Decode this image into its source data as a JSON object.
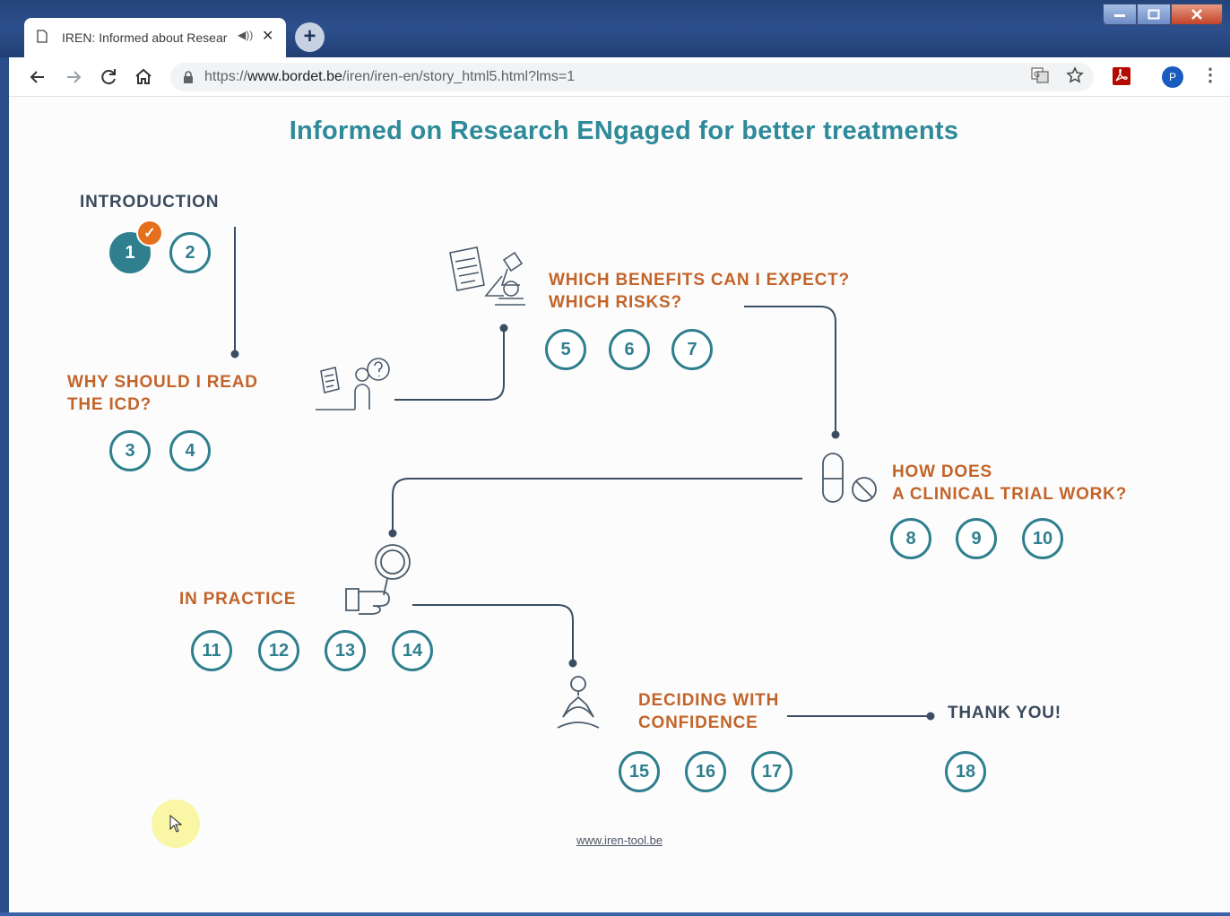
{
  "browser": {
    "tab_title": "IREN: Informed about Resear",
    "url_prefix": "https://",
    "url_host": "www.bordet.be",
    "url_path": "/iren/iren-en/story_html5.html?lms=1",
    "profile_initial": "P"
  },
  "page": {
    "title": "Informed on Research ENgaged for better treatments",
    "footer_link": "www.iren-tool.be",
    "accent_color": "#2f7f8f",
    "title_color": "#2e8a99",
    "section_color": "#c2642a",
    "check_color": "#e66f1e"
  },
  "sections": {
    "introduction": {
      "title": "INTRODUCTION",
      "modules": [
        "1",
        "2"
      ]
    },
    "why_read": {
      "line1": "WHY SHOULD I READ",
      "line2": "THE ICD?",
      "modules": [
        "3",
        "4"
      ]
    },
    "benefits": {
      "line1": "WHICH BENEFITS CAN I EXPECT?",
      "line2": "WHICH RISKS?",
      "modules": [
        "5",
        "6",
        "7"
      ]
    },
    "clinical_trial": {
      "line1": "HOW DOES",
      "line2": "A CLINICAL TRIAL WORK?",
      "modules": [
        "8",
        "9",
        "10"
      ]
    },
    "in_practice": {
      "title": "IN PRACTICE",
      "modules": [
        "11",
        "12",
        "13",
        "14"
      ]
    },
    "deciding": {
      "line1": "DECIDING WITH",
      "line2": "CONFIDENCE",
      "modules": [
        "15",
        "16",
        "17"
      ]
    },
    "thank_you": {
      "title": "THANK YOU!",
      "modules": [
        "18"
      ]
    }
  }
}
